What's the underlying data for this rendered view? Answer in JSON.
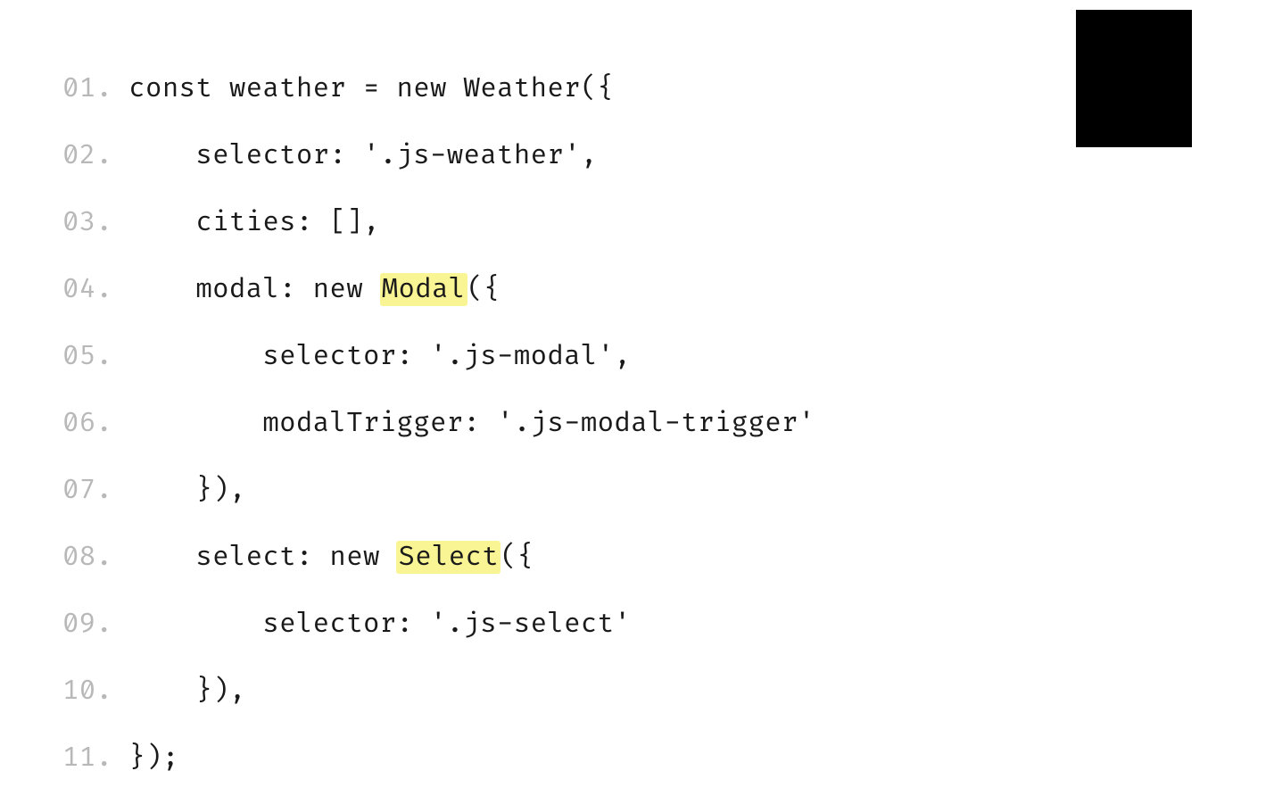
{
  "code": {
    "lines": [
      {
        "number": "01.",
        "segments": [
          {
            "text": "const weather = new Weather({",
            "highlight": false
          }
        ]
      },
      {
        "number": "02.",
        "segments": [
          {
            "text": "    selector: '.js-weather',",
            "highlight": false
          }
        ]
      },
      {
        "number": "03.",
        "segments": [
          {
            "text": "    cities: [],",
            "highlight": false
          }
        ]
      },
      {
        "number": "04.",
        "segments": [
          {
            "text": "    modal: new ",
            "highlight": false
          },
          {
            "text": "Modal",
            "highlight": true
          },
          {
            "text": "({",
            "highlight": false
          }
        ]
      },
      {
        "number": "05.",
        "segments": [
          {
            "text": "        selector: '.js-modal',",
            "highlight": false
          }
        ]
      },
      {
        "number": "06.",
        "segments": [
          {
            "text": "        modalTrigger: '.js-modal-trigger'",
            "highlight": false
          }
        ]
      },
      {
        "number": "07.",
        "segments": [
          {
            "text": "    }),",
            "highlight": false
          }
        ]
      },
      {
        "number": "08.",
        "segments": [
          {
            "text": "    select: new ",
            "highlight": false
          },
          {
            "text": "Select",
            "highlight": true
          },
          {
            "text": "({",
            "highlight": false
          }
        ]
      },
      {
        "number": "09.",
        "segments": [
          {
            "text": "        selector: '.js-select'",
            "highlight": false
          }
        ]
      },
      {
        "number": "10.",
        "segments": [
          {
            "text": "    }),",
            "highlight": false
          }
        ]
      },
      {
        "number": "11.",
        "segments": [
          {
            "text": "});",
            "highlight": false
          }
        ]
      }
    ]
  }
}
